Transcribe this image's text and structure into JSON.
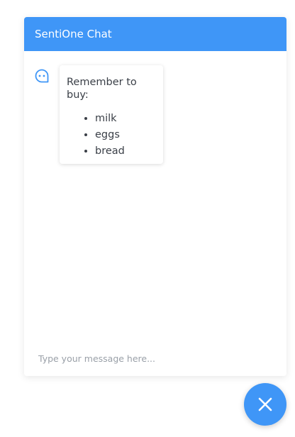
{
  "header": {
    "title": "SentiOne Chat"
  },
  "conversation": {
    "messages": [
      {
        "sender": "bot",
        "avatar_icon": "chat-bubble-icon",
        "heading": "Remember to buy:",
        "items": [
          "milk",
          "eggs",
          "bread"
        ]
      }
    ]
  },
  "input": {
    "placeholder": "Type your message here...",
    "value": ""
  },
  "toggle_button": {
    "icon": "close-icon"
  },
  "colors": {
    "brand": "#3f96f7",
    "text": "#3a3f47",
    "placeholder": "#9aa0a8"
  }
}
